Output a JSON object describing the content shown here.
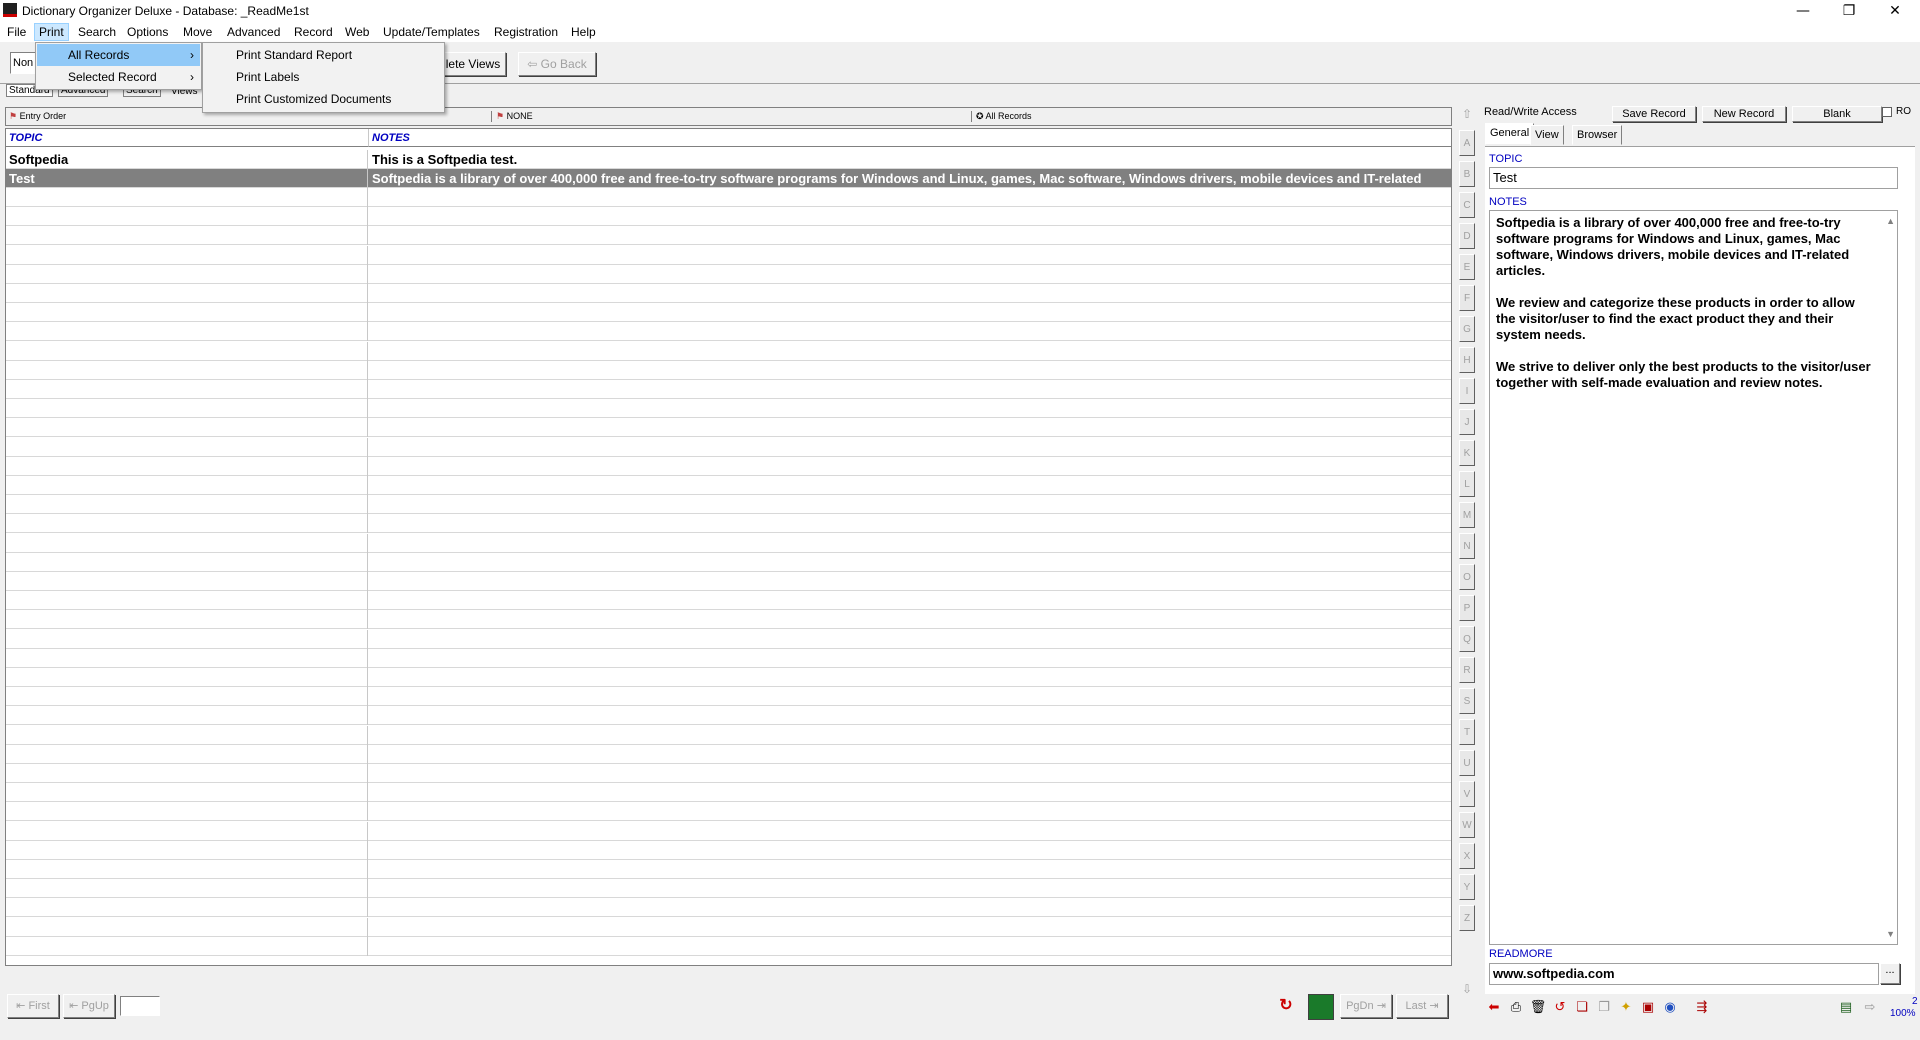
{
  "window": {
    "title": "Dictionary Organizer Deluxe - Database: _ReadMe1st",
    "minimize": "—",
    "maximize": "❐",
    "close": "✕"
  },
  "menubar": [
    "File",
    "Print",
    "Search",
    "Options",
    "Move",
    "Advanced",
    "Record",
    "Web",
    "Update/Templates",
    "Registration",
    "Help"
  ],
  "print_menu": {
    "items": [
      "All Records",
      "Selected Record"
    ]
  },
  "print_submenu": {
    "items": [
      "Print Standard Report",
      "Print Labels",
      "Print Customized Documents"
    ]
  },
  "toolbar": {
    "combo_value": "Non",
    "delete_views_label": "lete Views",
    "go_back_label": "Go Back"
  },
  "view_tabs": [
    "Standard",
    "Advanced",
    "Search",
    "Views"
  ],
  "sort_headers": [
    "Entry Order",
    "NONE",
    "All Records"
  ],
  "grid": {
    "columns": [
      "TOPIC",
      "NOTES"
    ],
    "rows": [
      {
        "topic": "Softpedia",
        "notes": "This is a Softpedia test."
      },
      {
        "topic": "Test",
        "notes": "Softpedia is a library of over 400,000 free and free-to-try software programs for Windows and Linux, games, Mac software, Windows drivers, mobile devices and IT-related"
      }
    ]
  },
  "alphabet": [
    "A",
    "B",
    "C",
    "D",
    "E",
    "F",
    "G",
    "H",
    "I",
    "J",
    "K",
    "L",
    "M",
    "N",
    "O",
    "P",
    "Q",
    "R",
    "S",
    "T",
    "U",
    "V",
    "W",
    "X",
    "Y",
    "Z"
  ],
  "nav": {
    "first": "First",
    "pgup": "PgUp",
    "pgdn": "PgDn",
    "last": "Last"
  },
  "record_panel": {
    "access": "Read/Write Access",
    "save": "Save Record",
    "new": "New Record",
    "blank": "Blank",
    "ro": "RO",
    "tabs": [
      "General",
      "View",
      "Browser"
    ],
    "topic_label": "TOPIC",
    "topic_value": "Test",
    "notes_label": "NOTES",
    "notes_paragraphs": [
      "Softpedia is a library of over 400,000 free and free-to-try software programs for Windows and Linux, games, Mac software, Windows drivers, mobile devices and IT-related articles.",
      "We review and categorize these products in order to allow the visitor/user to find the exact product they and their system needs.",
      "We strive to deliver only the best products to the visitor/user together with self-made evaluation and review notes."
    ],
    "readmore_label": "READMORE",
    "readmore_value": "www.softpedia.com",
    "readmore_btn": "..."
  },
  "status": {
    "zoom_num": "2",
    "zoom": "100%"
  }
}
